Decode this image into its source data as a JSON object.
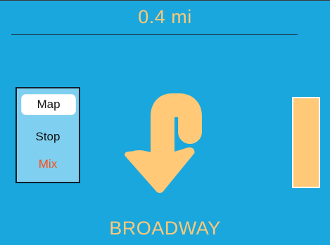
{
  "navigation": {
    "distance": "0.4 mi",
    "street": "BROADWAY",
    "maneuver_icon": "u-turn-left-arrow-icon"
  },
  "mode_menu": {
    "items": [
      {
        "label": "Map",
        "selected": true
      },
      {
        "label": "Stop",
        "selected": false
      },
      {
        "label": "Mix",
        "selected": false
      }
    ]
  },
  "colors": {
    "background": "#1aa7dd",
    "accent": "#ffc977",
    "mix_text": "#ff4a13",
    "panel": "#7fd0f0"
  }
}
